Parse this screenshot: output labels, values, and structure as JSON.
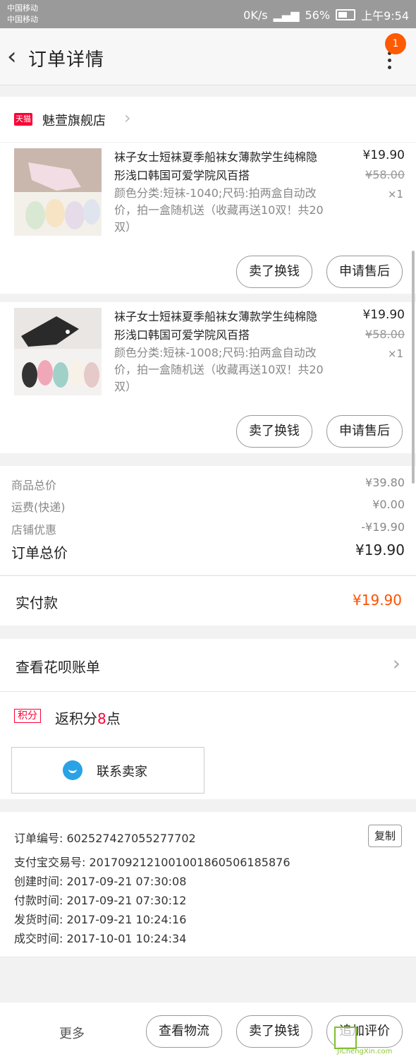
{
  "status": {
    "carrier1": "中国移动",
    "carrier2": "中国移动",
    "speed": "0K/s",
    "battery": "56%",
    "time": "上午9:54"
  },
  "nav": {
    "title": "订单详情",
    "badge": "1"
  },
  "shop": {
    "logo": "天猫",
    "name": "魅萱旗舰店"
  },
  "items": [
    {
      "title": "袜子女士短袜夏季船袜女薄款学生纯棉隐形浅口韩国可爱学院风百搭",
      "spec": "颜色分类:短袜-1040;尺码:拍两盒自动改价，拍一盒随机送（收藏再送10双！共20双）",
      "price": "¥19.90",
      "original_price": "¥58.00",
      "qty": "×1",
      "btn_sell": "卖了换钱",
      "btn_after": "申请售后"
    },
    {
      "title": "袜子女士短袜夏季船袜女薄款学生纯棉隐形浅口韩国可爱学院风百搭",
      "spec": "颜色分类:短袜-1008;尺码:拍两盒自动改价，拍一盒随机送（收藏再送10双！共20双）",
      "price": "¥19.90",
      "original_price": "¥58.00",
      "qty": "×1",
      "btn_sell": "卖了换钱",
      "btn_after": "申请售后"
    }
  ],
  "totals": {
    "goods_label": "商品总价",
    "goods": "¥39.80",
    "ship_label": "运费(快递)",
    "ship": "¥0.00",
    "discount_label": "店铺优惠",
    "discount": "-¥19.90",
    "order_label": "订单总价",
    "order": "¥19.90"
  },
  "paid": {
    "label": "实付款",
    "amount": "¥19.90"
  },
  "huabei": {
    "label": "查看花呗账单"
  },
  "points": {
    "tag": "积分",
    "prefix": "返积分",
    "num": "8",
    "suffix": "点"
  },
  "contact": {
    "label": "联系卖家"
  },
  "info": {
    "order_no": "订单编号: 602527427055277702",
    "alipay_no": "支付宝交易号: 2017092121001001860506185876",
    "created": "创建时间: 2017-09-21 07:30:08",
    "paid": "付款时间: 2017-09-21 07:30:12",
    "shipped": "发货时间: 2017-09-21 10:24:16",
    "completed": "成交时间: 2017-10-01 10:24:34",
    "copy": "复制"
  },
  "bottom": {
    "more": "更多",
    "logistics": "查看物流",
    "sell": "卖了换钱",
    "review": "追加评价"
  },
  "watermark": {
    "text": "JiChengXin.com"
  }
}
